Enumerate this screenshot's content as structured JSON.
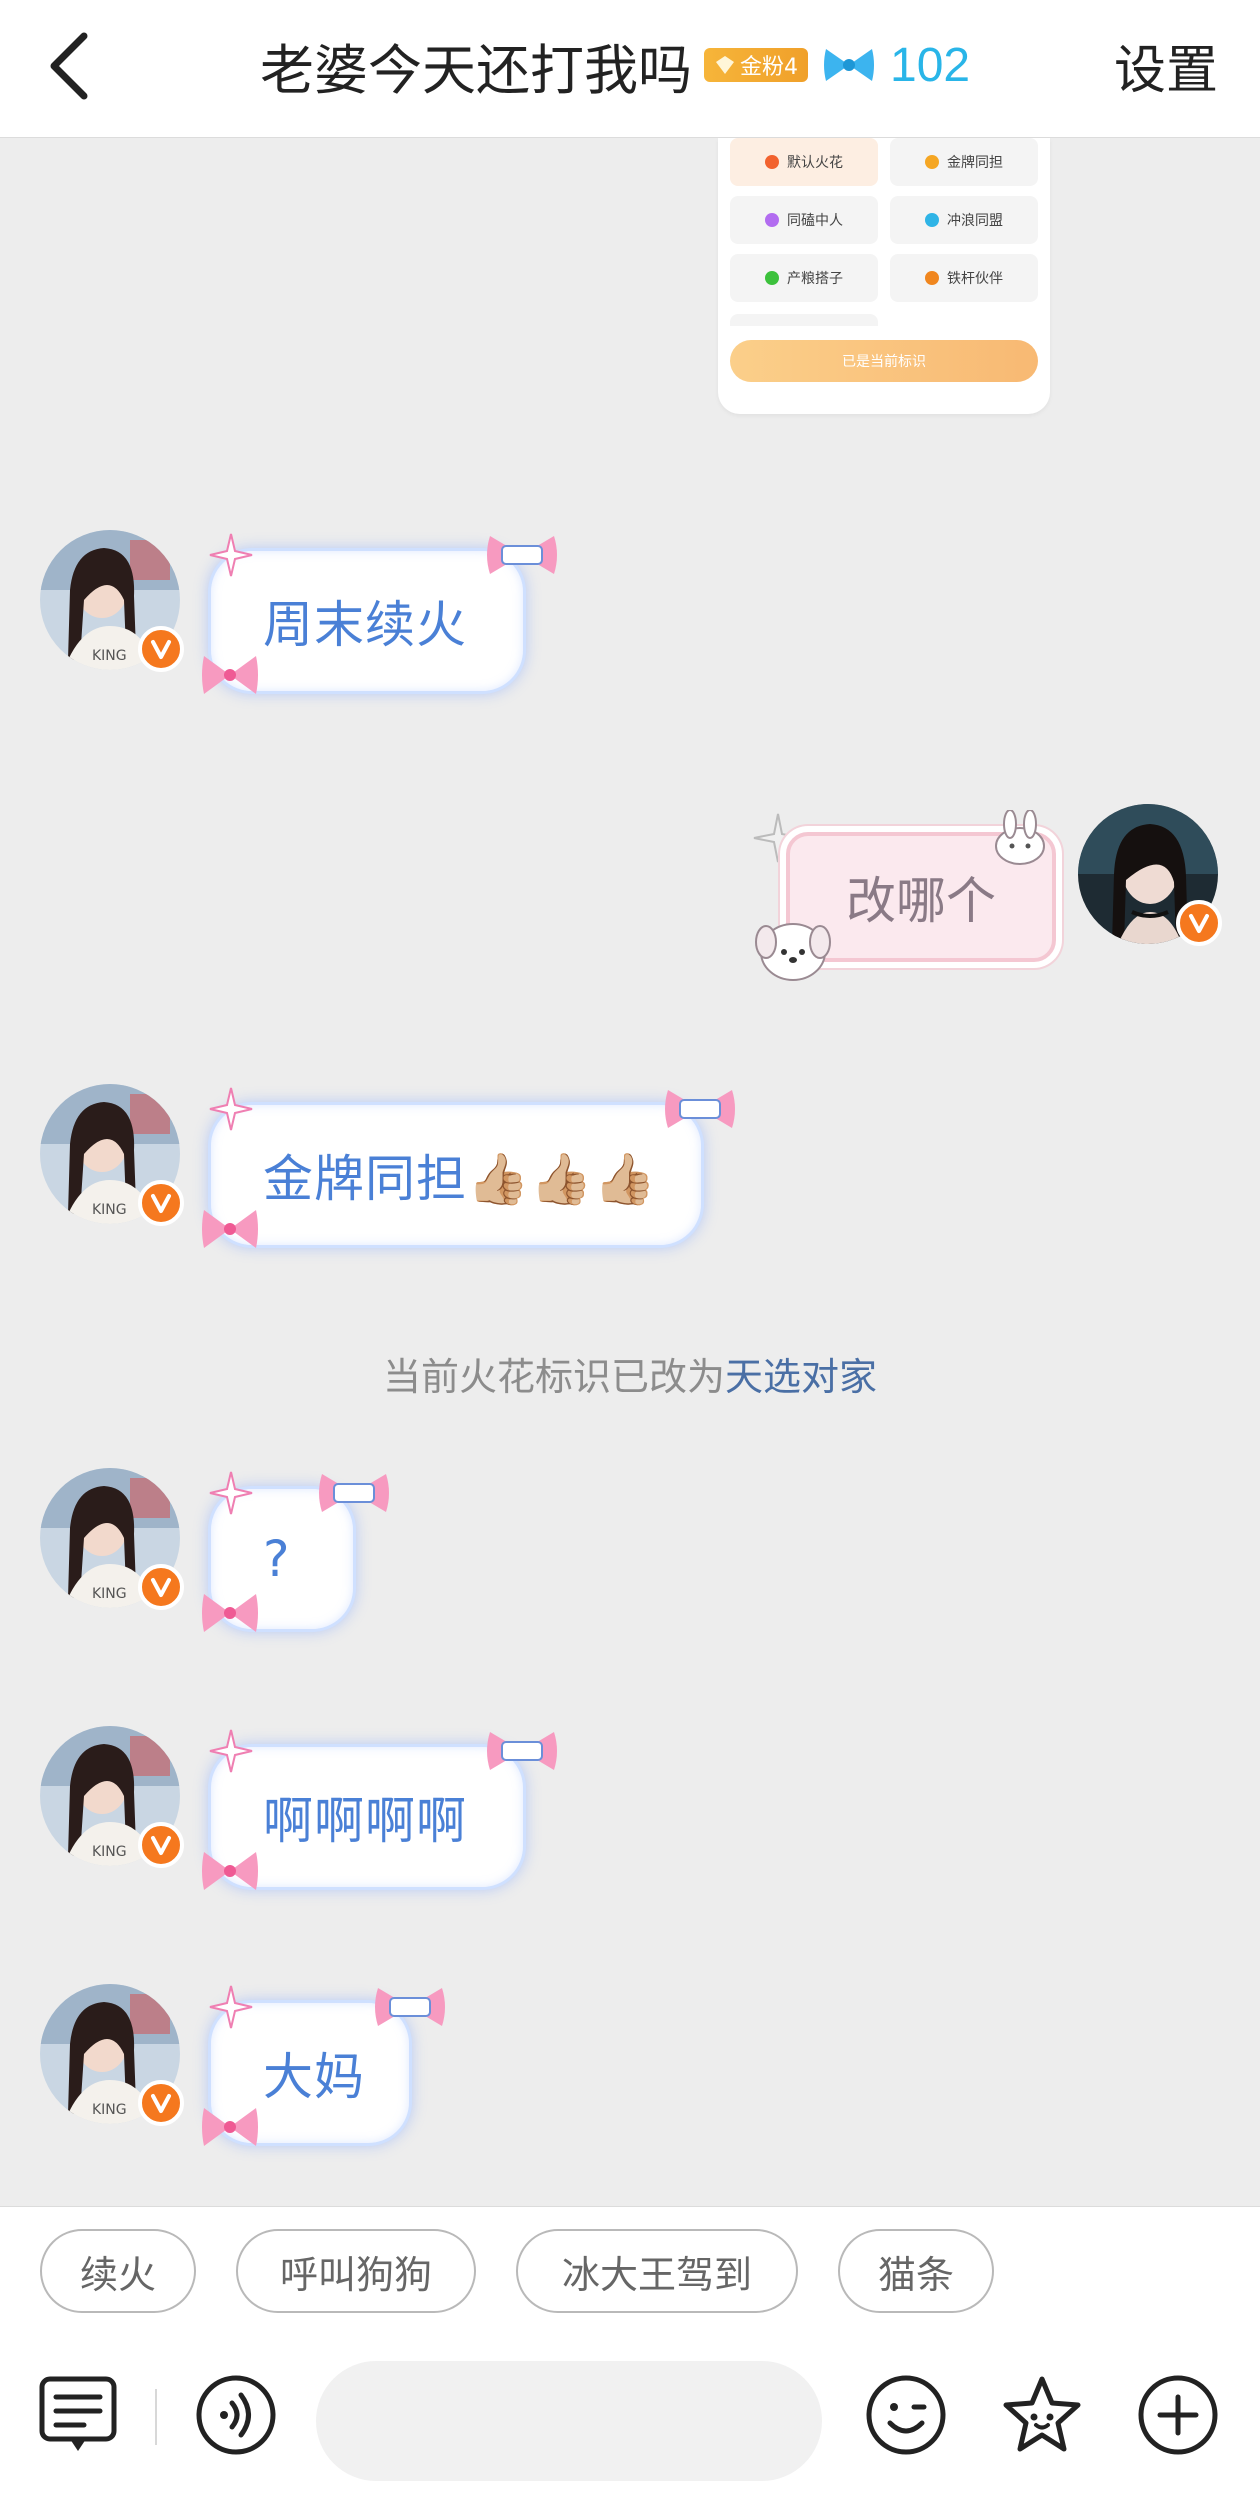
{
  "header": {
    "back_icon": "chevron-left-icon",
    "title": "老婆今天还打我吗",
    "fan_badge": "金粉4",
    "fire_count": "102",
    "settings": "设置"
  },
  "screenshot_card": {
    "items": [
      "默认火花",
      "金牌同担",
      "同磕中人",
      "冲浪同盟",
      "产粮搭子",
      "铁杆伙伴"
    ],
    "button": "已是当前标识",
    "colors": {
      "active": "#fdeee2",
      "button": "#f8b973"
    }
  },
  "messages": [
    {
      "side": "left",
      "text": "周末续火"
    },
    {
      "side": "right",
      "text": "改哪个"
    },
    {
      "side": "left",
      "text": "金牌同担👍🏼👍🏼👍🏼"
    },
    {
      "side": "left",
      "text": "?"
    },
    {
      "side": "left",
      "text": "啊啊啊啊"
    },
    {
      "side": "left",
      "text": "大妈"
    }
  ],
  "system_message": {
    "prefix": "当前火花标识已改为",
    "highlight": "天选对家"
  },
  "quick_replies": [
    "续火",
    "呼叫狗狗",
    "冰大王驾到",
    "猫条"
  ],
  "toolbar": {
    "icons": [
      "notepad-icon",
      "voice-icon",
      "emoji-icon",
      "sticker-icon",
      "plus-icon"
    ]
  },
  "colors": {
    "accent": "#29b5e8",
    "bubble_text": "#4a80d6",
    "system_highlight": "#4a6fa5",
    "badge": "#f5781e"
  }
}
